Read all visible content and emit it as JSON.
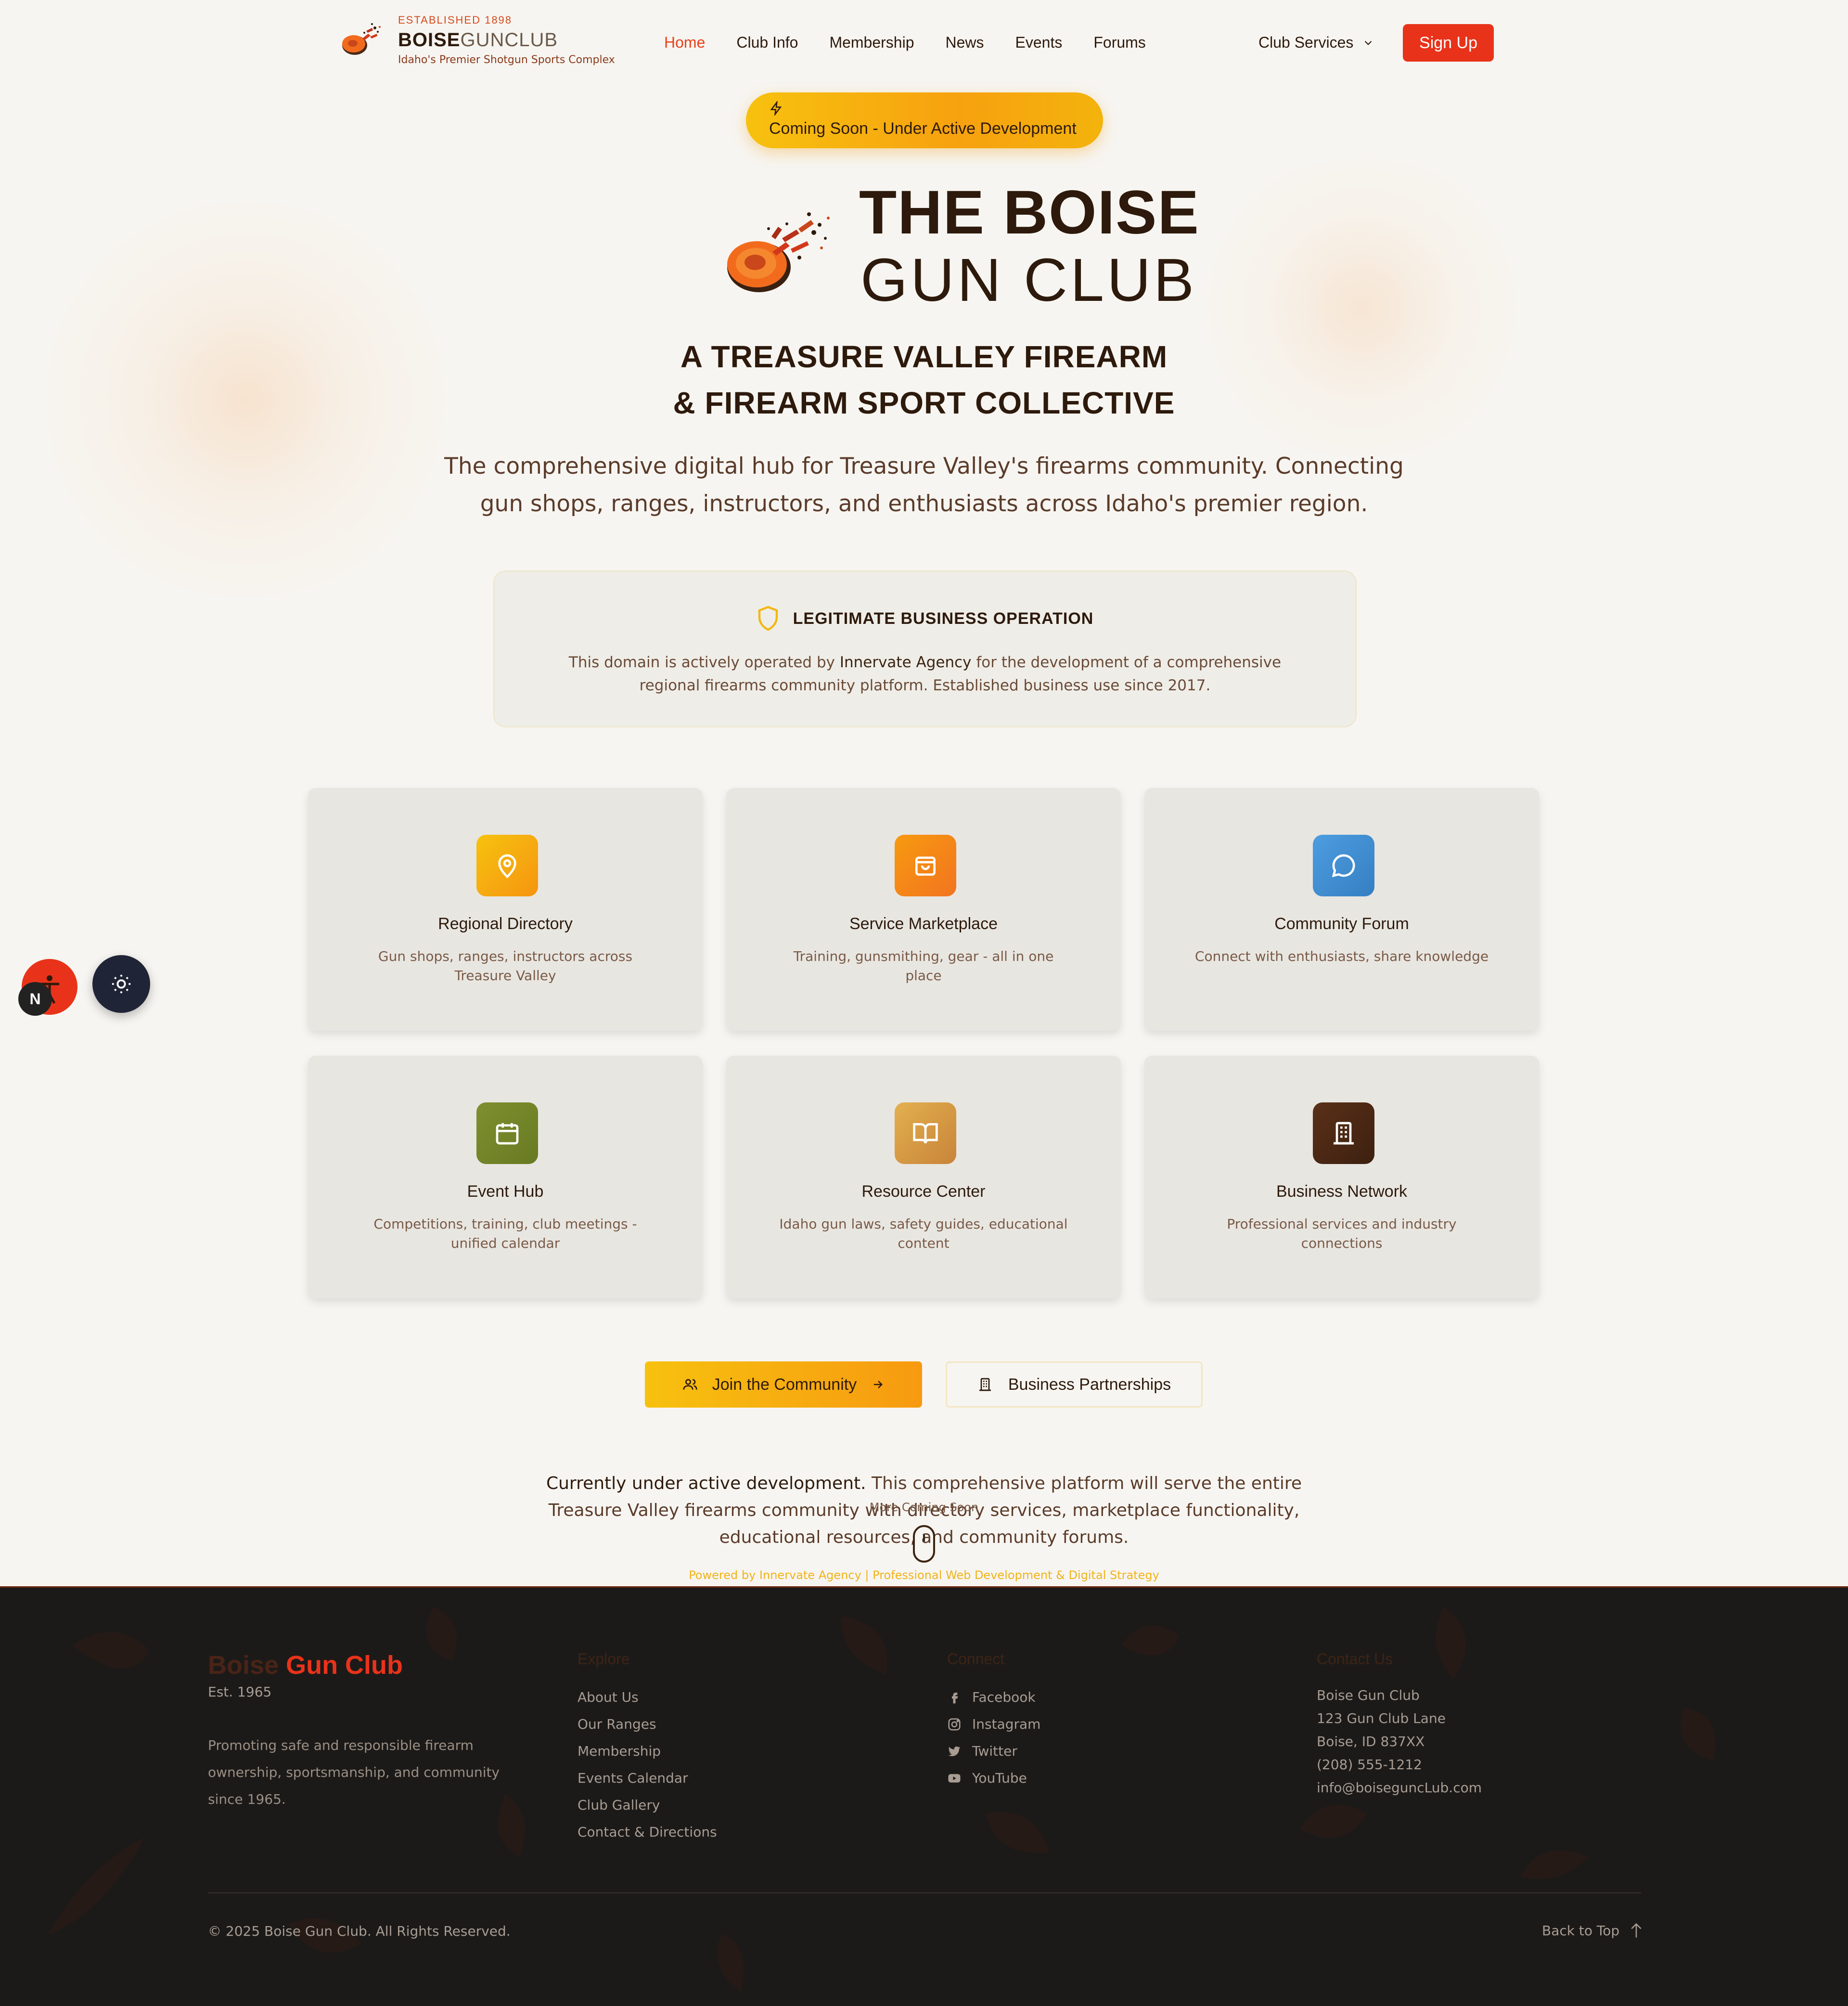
{
  "nav": {
    "brand_established": "ESTABLISHED 1898",
    "brand_name_bold": "BOISE",
    "brand_name_light": "GUNCLUB",
    "brand_tagline": "Idaho's Premier Shotgun Sports Complex",
    "links": [
      "Home",
      "Club Info",
      "Membership",
      "News",
      "Events",
      "Forums"
    ],
    "active": "Home",
    "club_services": "Club Services",
    "signup": "Sign Up"
  },
  "hero": {
    "badge_icon": "lightning-icon",
    "badge": "Coming Soon - Under Active Development",
    "title_line1": "THE BOISE",
    "title_line2": "GUN CLUB",
    "subtitle_line1": "A TREASURE VALLEY FIREARM",
    "subtitle_line2": "& FIREARM SPORT COLLECTIVE",
    "lead": "The comprehensive digital hub for Treasure Valley's firearms community. Connecting gun shops, ranges, instructors, and enthusiasts across Idaho's premier region."
  },
  "legit": {
    "icon": "shield-icon",
    "title": "LEGITIMATE BUSINESS OPERATION",
    "body_pre": "This domain is actively operated by ",
    "body_strong": "Innervate Agency",
    "body_post": " for the development of a comprehensive regional firearms community platform. Established business use since 2017."
  },
  "features": [
    {
      "title": "Regional Directory",
      "desc": "Gun shops, ranges, instructors across Treasure Valley",
      "icon": "map-pin-icon",
      "color": "#f5a510"
    },
    {
      "title": "Service Marketplace",
      "desc": "Training, gunsmithing, gear - all in one place",
      "icon": "shopping-bag-icon",
      "color": "#f5841a"
    },
    {
      "title": "Community Forum",
      "desc": "Connect with enthusiasts, share knowledge",
      "icon": "chat-bubble-icon",
      "color": "#3f8fd1"
    },
    {
      "title": "Event Hub",
      "desc": "Competitions, training, club meetings - unified calendar",
      "icon": "calendar-icon",
      "color": "#74852a"
    },
    {
      "title": "Resource Center",
      "desc": "Idaho gun laws, safety guides, educational content",
      "icon": "book-open-icon",
      "color": "#d79a45"
    },
    {
      "title": "Business Network",
      "desc": "Professional services and industry connections",
      "icon": "building-icon",
      "color": "#4a2915"
    }
  ],
  "cta": {
    "join": "Join the Community",
    "business": "Business Partnerships"
  },
  "development": {
    "strong": "Currently under active development.",
    "text": " This comprehensive platform will serve the entire Treasure Valley firearms community with directory services, marketplace functionality, educational resources, and community forums.",
    "more_coming": "More Coming Soon",
    "powered": "Powered by Innervate Agency | Professional Web Development & Digital Strategy"
  },
  "floating": {
    "n_badge": "N"
  },
  "footer": {
    "brand_dim": "Boise",
    "brand_red": "Gun Club",
    "est": "Est. 1965",
    "description": "Promoting safe and responsible firearm ownership, sportsmanship, and community since 1965.",
    "explore_title": "Explore",
    "explore": [
      "About Us",
      "Our Ranges",
      "Membership",
      "Events Calendar",
      "Club Gallery",
      "Contact & Directions"
    ],
    "connect_title": "Connect",
    "connect": [
      {
        "label": "Facebook",
        "icon": "facebook-icon"
      },
      {
        "label": "Instagram",
        "icon": "instagram-icon"
      },
      {
        "label": "Twitter",
        "icon": "twitter-icon"
      },
      {
        "label": "YouTube",
        "icon": "youtube-icon"
      }
    ],
    "contact_title": "Contact Us",
    "contact": [
      "Boise Gun Club",
      "123 Gun Club Lane",
      "Boise, ID 837XX",
      "(208) 555-1212",
      "info@boiseguncLub.com"
    ],
    "copyright": "© 2025 Boise Gun Club. All Rights Reserved.",
    "back_to_top": "Back to Top"
  }
}
